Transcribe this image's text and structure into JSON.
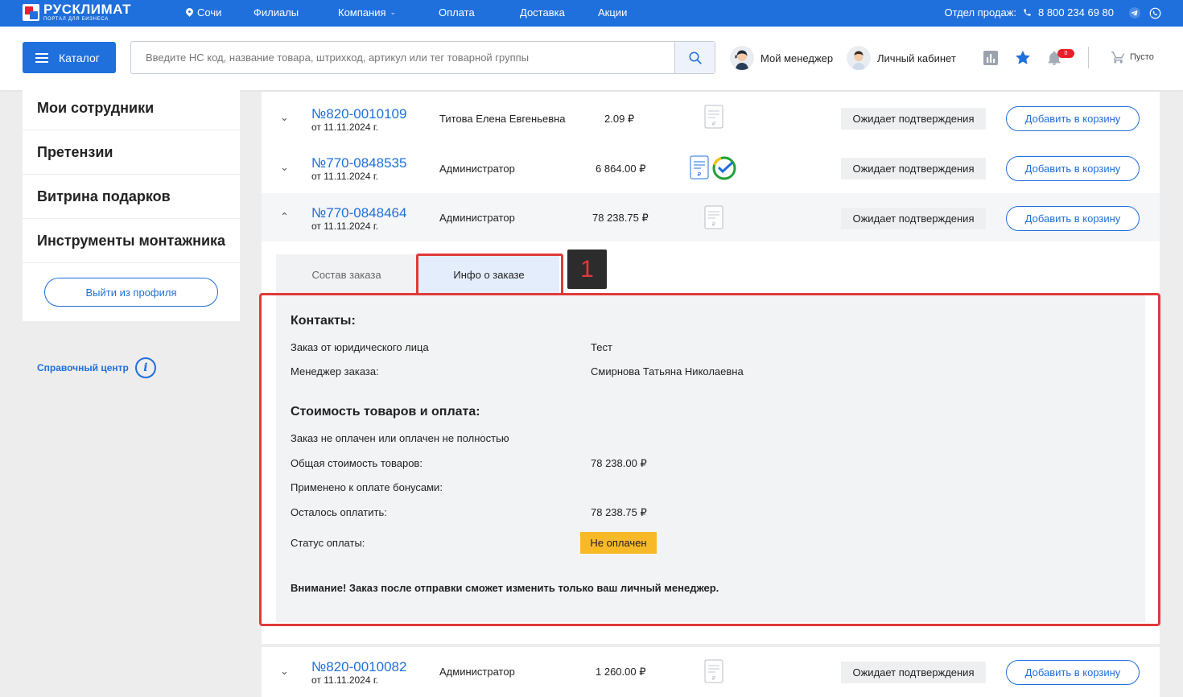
{
  "topbar": {
    "logo_main": "РУСКЛИМАТ",
    "logo_sub": "ПОРТАЛ ДЛЯ БИЗНЕСА",
    "city": "Сочи",
    "nav": [
      "Филиалы",
      "Компания",
      "Оплата",
      "Доставка",
      "Акции"
    ],
    "sales_label": "Отдел продаж:",
    "phone": "8 800 234 69 80"
  },
  "header": {
    "catalog_label": "Каталог",
    "search_placeholder": "Введите НС код, название товара, штрихкод, артикул или тег товарной группы",
    "manager_label": "Мой менеджер",
    "cabinet_label": "Личный кабинет",
    "notifications_count": "0",
    "cart_label": "Пусто"
  },
  "sidebar": {
    "items": [
      "Мои сотрудники",
      "Претензии",
      "Витрина подарков",
      "Инструменты монтажника"
    ],
    "logout_label": "Выйти из профиля",
    "help_label": "Справочный центр"
  },
  "orders": [
    {
      "number": "№820-0010109",
      "date": "от 11.11.2024 г.",
      "author": "Титова Елена Евгеньевна",
      "sum": "2.09 ₽",
      "status": "Ожидает подтверждения",
      "cart_label": "Добавить в корзину"
    },
    {
      "number": "№770-0848535",
      "date": "от 11.11.2024 г.",
      "author": "Администратор",
      "sum": "6 864.00 ₽",
      "status": "Ожидает подтверждения",
      "cart_label": "Добавить в корзину"
    },
    {
      "number": "№770-0848464",
      "date": "от 11.11.2024 г.",
      "author": "Администратор",
      "sum": "78 238.75 ₽",
      "status": "Ожидает подтверждения",
      "cart_label": "Добавить в корзину"
    },
    {
      "number": "№820-0010082",
      "date": "от 11.11.2024 г.",
      "author": "Администратор",
      "sum": "1 260.00 ₽",
      "status": "Ожидает подтверждения",
      "cart_label": "Добавить в корзину"
    }
  ],
  "detail": {
    "tab_compose": "Состав заказа",
    "tab_info": "Инфо о заказе",
    "marker": "1",
    "contacts_title": "Контакты:",
    "legal_label": "Заказ от юридического лица",
    "legal_value": "Тест",
    "manager_label": "Менеджер заказа:",
    "manager_value": "Смирнова Татьяна Николаевна",
    "payment_title": "Стоимость товаров и оплата:",
    "payment_note": "Заказ не оплачен или оплачен не полностью",
    "total_label": "Общая стоимость товаров:",
    "total_value": "78 238.00 ₽",
    "bonus_label": "Применено к оплате бонусами:",
    "remain_label": "Осталось оплатить:",
    "remain_value": "78 238.75 ₽",
    "status_label": "Статус оплаты:",
    "status_value": "Не оплачен",
    "warning": "Внимание! Заказ после отправки сможет изменить только ваш личный менеджер."
  },
  "colors": {
    "brand_blue": "#1f6fdc",
    "highlight_red": "#e03a3a",
    "unpaid_yellow": "#f7b928"
  }
}
